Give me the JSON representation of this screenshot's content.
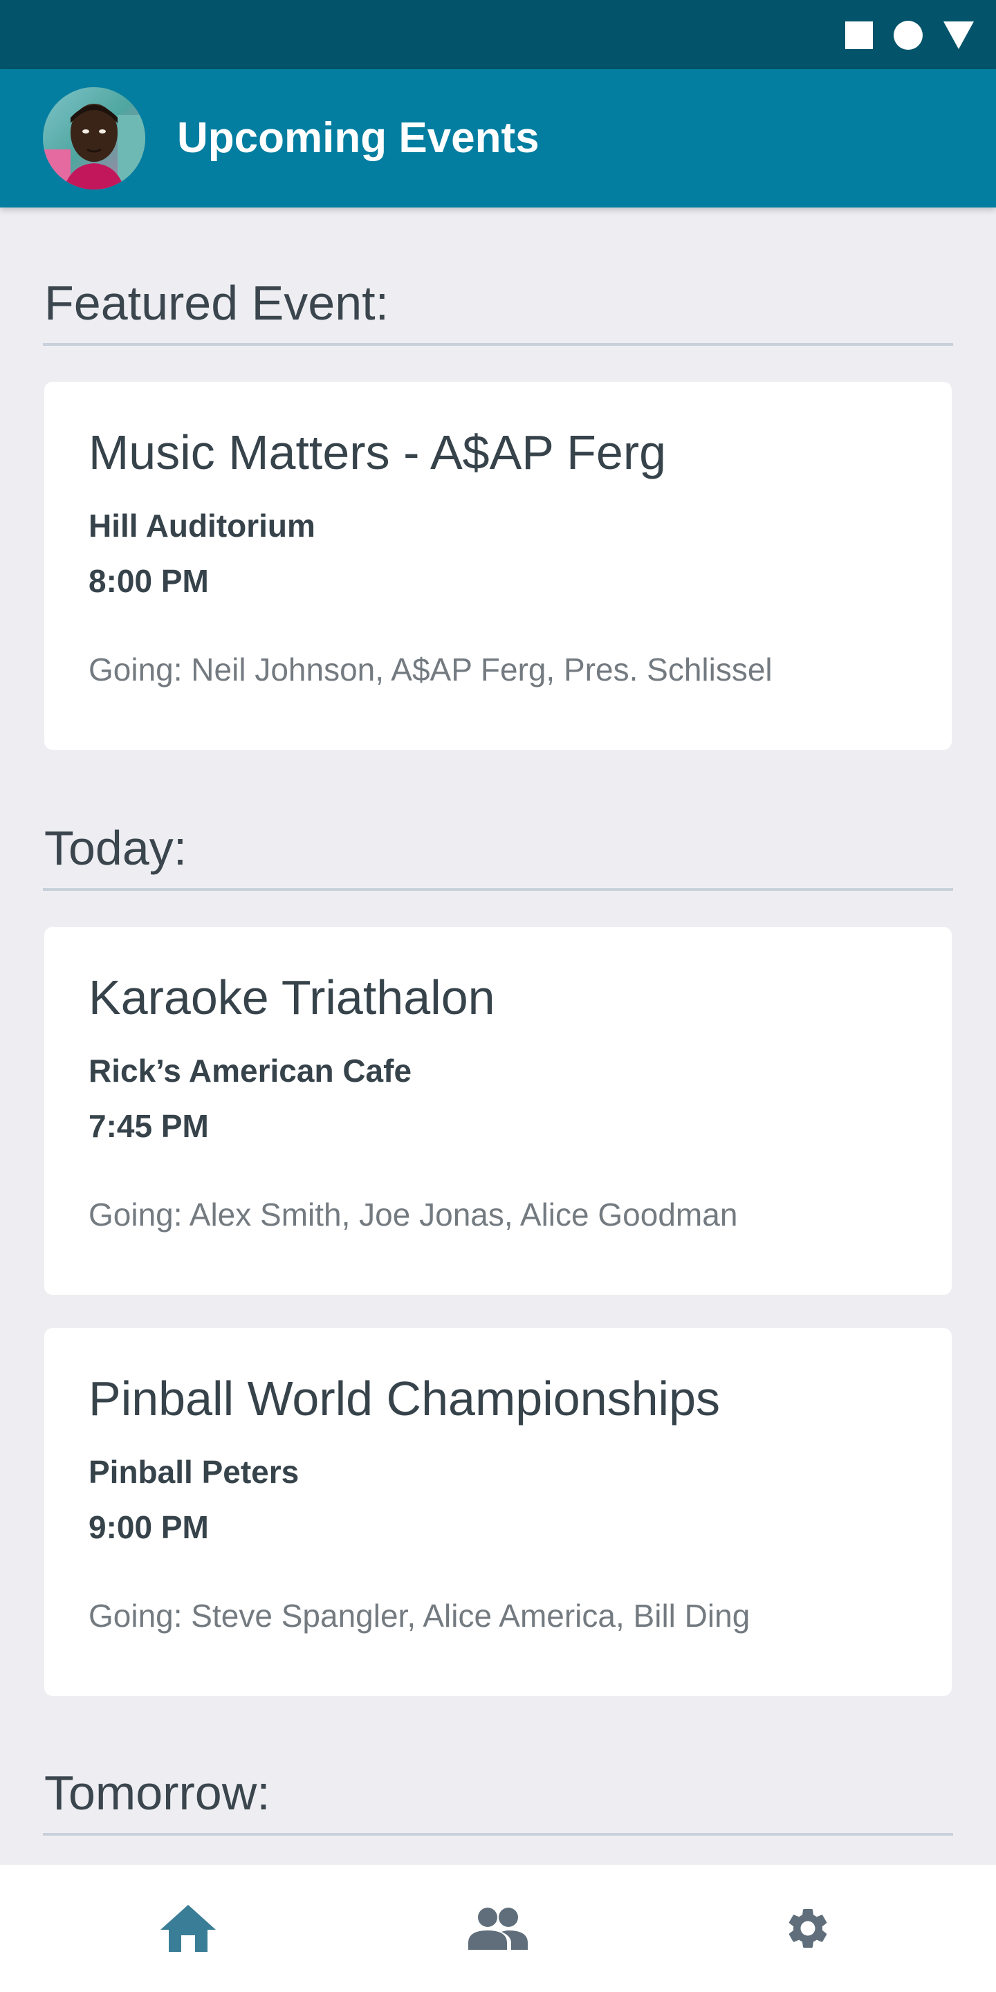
{
  "status_bar": {
    "icons": [
      "square-icon",
      "circle-icon",
      "triangle-icon"
    ]
  },
  "app_bar": {
    "title": "Upcoming Events",
    "avatar_icon": "user-avatar"
  },
  "sections": {
    "featured": {
      "title": "Featured Event:",
      "events": [
        {
          "title": "Music Matters - A$AP Ferg",
          "venue": "Hill Auditorium",
          "time": "8:00 PM",
          "going": "Going: Neil Johnson, A$AP Ferg, Pres. Schlissel"
        }
      ]
    },
    "today": {
      "title": "Today:",
      "events": [
        {
          "title": "Karaoke Triathalon",
          "venue": "Rick’s American Cafe",
          "time": "7:45 PM",
          "going": "Going: Alex Smith, Joe Jonas, Alice Goodman"
        },
        {
          "title": "Pinball World Championships",
          "venue": "Pinball Peters",
          "time": "9:00 PM",
          "going": "Going: Steve Spangler, Alice America, Bill Ding"
        }
      ]
    },
    "tomorrow": {
      "title": "Tomorrow:"
    }
  },
  "bottom_nav": {
    "items": [
      {
        "icon": "home-icon",
        "active": true
      },
      {
        "icon": "people-icon",
        "active": false
      },
      {
        "icon": "gear-icon",
        "active": false
      }
    ]
  },
  "colors": {
    "status_bar": "#03546A",
    "app_bar": "#047EA0",
    "background": "#EEEEF2",
    "nav_active": "#3A7D96",
    "nav_inactive": "#5F6E7A"
  }
}
